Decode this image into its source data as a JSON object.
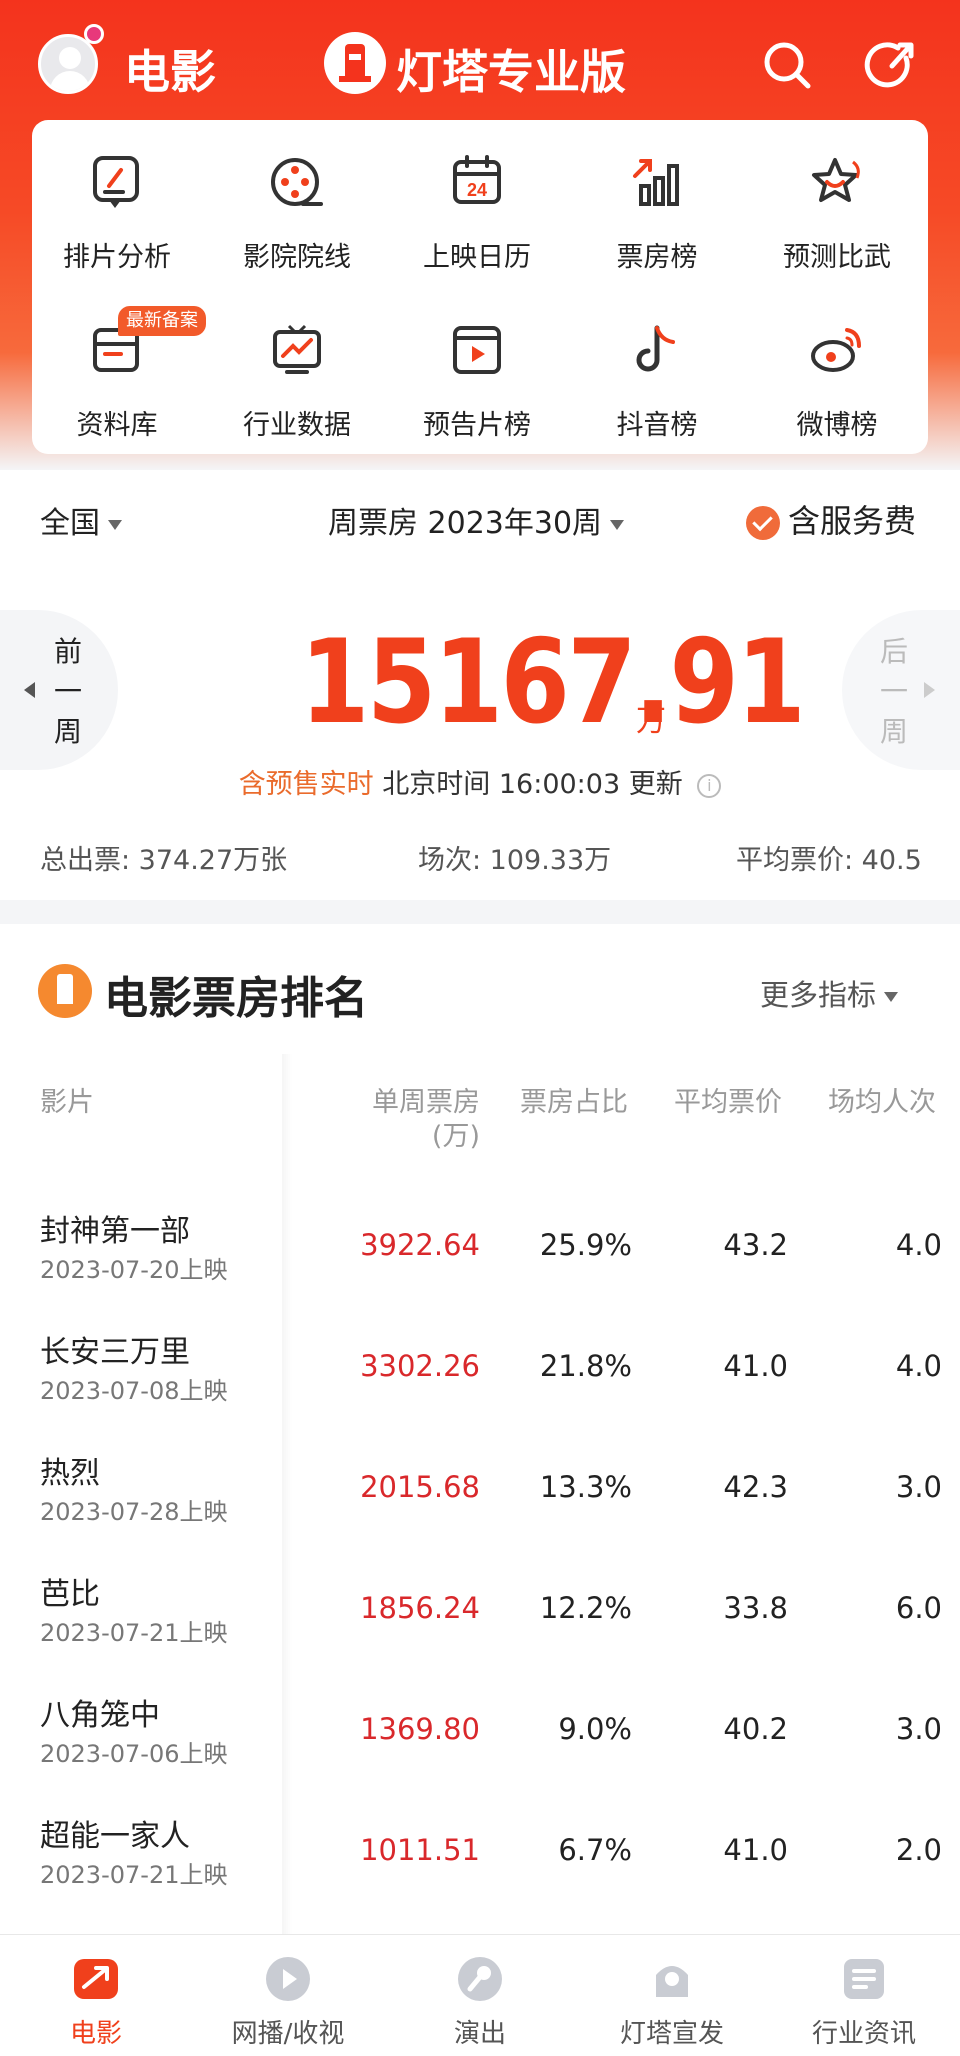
{
  "header": {
    "title": "电影",
    "brand": "灯塔专业版"
  },
  "menu": {
    "items": [
      {
        "label": "排片分析",
        "icon": "schedule-analysis-icon"
      },
      {
        "label": "影院院线",
        "icon": "film-reel-icon"
      },
      {
        "label": "上映日历",
        "icon": "calendar-icon",
        "day": "24"
      },
      {
        "label": "票房榜",
        "icon": "bar-chart-icon"
      },
      {
        "label": "预测比武",
        "icon": "star-predict-icon"
      },
      {
        "label": "资料库",
        "icon": "database-icon",
        "badge": "最新备案"
      },
      {
        "label": "行业数据",
        "icon": "trend-board-icon"
      },
      {
        "label": "预告片榜",
        "icon": "trailer-play-icon"
      },
      {
        "label": "抖音榜",
        "icon": "douyin-icon"
      },
      {
        "label": "微博榜",
        "icon": "weibo-icon"
      }
    ]
  },
  "summary": {
    "region": "全国",
    "period": "周票房 2023年30周",
    "service_fee": "含服务费",
    "prev_week": "前一周",
    "next_week": "后一周",
    "total": "15167.91",
    "unit": "万",
    "presale": "含预售实时",
    "update_time": "北京时间 16:00:03 更新",
    "tickets": "总出票: 374.27万张",
    "shows": "场次: 109.33万",
    "avg_price": "平均票价: 40.5"
  },
  "ranking": {
    "title": "电影票房排名",
    "more": "更多指标",
    "columns": {
      "film": "影片",
      "gross": "单周票房",
      "gross_unit": "(万)",
      "share": "票房占比",
      "avg_price": "平均票价",
      "per_show": "场均人次"
    },
    "rows": [
      {
        "name": "封神第一部",
        "date": "2023-07-20上映",
        "gross": "3922.64",
        "share": "25.9%",
        "avg": "43.2",
        "per_show": "4.0"
      },
      {
        "name": "长安三万里",
        "date": "2023-07-08上映",
        "gross": "3302.26",
        "share": "21.8%",
        "avg": "41.0",
        "per_show": "4.0"
      },
      {
        "name": "热烈",
        "date": "2023-07-28上映",
        "gross": "2015.68",
        "share": "13.3%",
        "avg": "42.3",
        "per_show": "3.0"
      },
      {
        "name": "芭比",
        "date": "2023-07-21上映",
        "gross": "1856.24",
        "share": "12.2%",
        "avg": "33.8",
        "per_show": "6.0"
      },
      {
        "name": "八角笼中",
        "date": "2023-07-06上映",
        "gross": "1369.80",
        "share": "9.0%",
        "avg": "40.2",
        "per_show": "3.0"
      },
      {
        "name": "超能一家人",
        "date": "2023-07-21上映",
        "gross": "1011.51",
        "share": "6.7%",
        "avg": "41.0",
        "per_show": "2.0"
      }
    ]
  },
  "tabs": [
    {
      "label": "电影",
      "active": true
    },
    {
      "label": "网播/收视",
      "active": false
    },
    {
      "label": "演出",
      "active": false
    },
    {
      "label": "灯塔宣发",
      "active": false
    },
    {
      "label": "行业资讯",
      "active": false
    }
  ],
  "colors": {
    "brand_red": "#f0401c",
    "gross_red": "#d9282b",
    "presale_orange": "#ea6b2c"
  }
}
